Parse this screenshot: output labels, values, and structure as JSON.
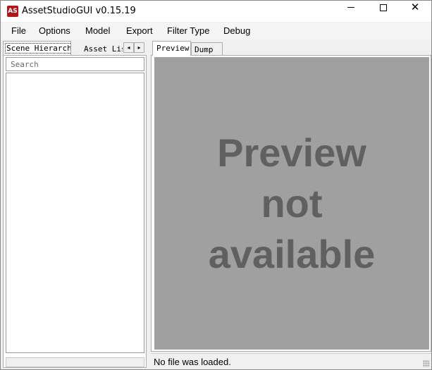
{
  "window": {
    "title": "AssetStudioGUI v0.15.19",
    "icon_label": "AS",
    "controls": {
      "minimize": "minimize-icon",
      "maximize": "maximize-icon",
      "close": "✕"
    }
  },
  "menu": {
    "items": [
      "File",
      "Options",
      "Model",
      "Export",
      "Filter Type",
      "Debug"
    ]
  },
  "left_panel": {
    "tabs": [
      {
        "label": "Scene Hierarchy",
        "selected": true
      },
      {
        "label": "Asset List",
        "selected": false
      }
    ],
    "scroll_left": "◂",
    "scroll_right": "▸",
    "search": {
      "placeholder": "Search",
      "value": ""
    }
  },
  "right_panel": {
    "tabs": [
      {
        "label": "Preview",
        "selected": true
      },
      {
        "label": "Dump",
        "selected": false
      }
    ],
    "preview_message": [
      "Preview",
      "not",
      "available"
    ]
  },
  "status": {
    "text": "No file was loaded."
  },
  "colors": {
    "app_icon": "#b0161b",
    "preview_bg": "#a0a0a0",
    "preview_text": "#606060"
  }
}
